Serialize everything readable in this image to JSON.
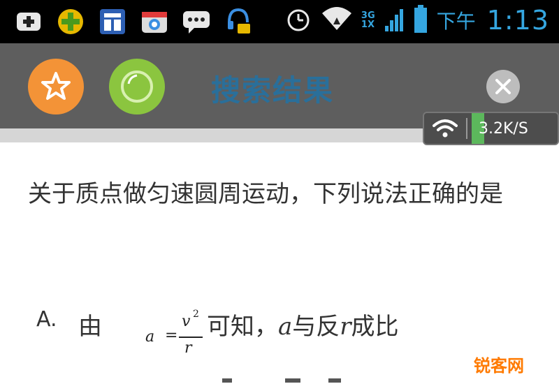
{
  "status_bar": {
    "ampm": "下午",
    "time": "1:13",
    "network_top": "3G",
    "network_bottom": "1X",
    "icons": [
      "add-icon",
      "game-icon",
      "app-icon",
      "camera-app-icon",
      "chat-icon",
      "headset-icon",
      "alarm-icon",
      "wifi-icon",
      "signal-icon",
      "battery-icon"
    ]
  },
  "header": {
    "title": "搜索结果",
    "star_button": "star-icon",
    "green_button": "circle-icon",
    "close_button": "close-icon"
  },
  "speed_widget": {
    "text": "3.2K/S"
  },
  "question": {
    "text": "关于质点做匀速圆周运动，下列说法正确的是"
  },
  "option_a": {
    "label": "A.",
    "prefix": "由",
    "formula": {
      "lhs": "a",
      "eq": "=",
      "numerator": "v",
      "exponent": "2",
      "denominator": "r"
    },
    "suffix_1": "可知，",
    "var_a": "a",
    "suffix_2": "与反",
    "var_r": "r",
    "suffix_3": "成比"
  },
  "watermark": "锐客网",
  "colors": {
    "accent_blue": "#35a6e0",
    "title_blue": "#2a6f9a",
    "star_orange": "#f39337",
    "green": "#8bc53f",
    "watermark_orange": "#ff7a00"
  }
}
